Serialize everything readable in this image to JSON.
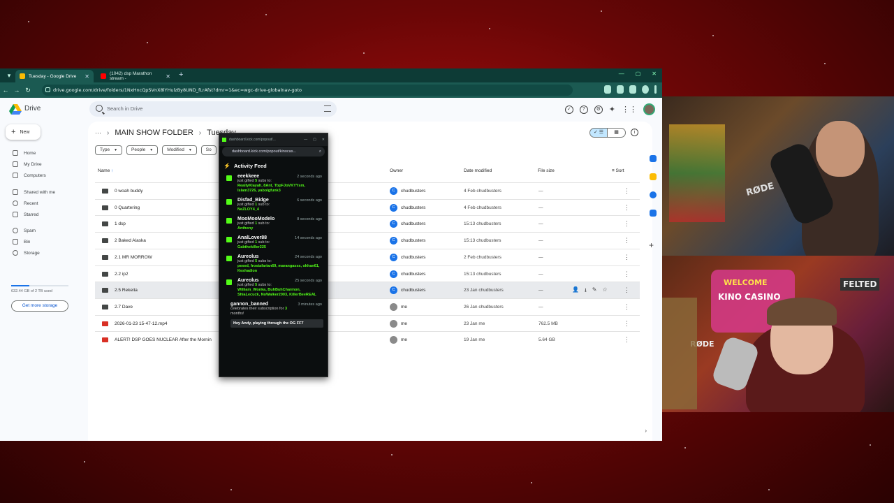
{
  "browser": {
    "tabs": [
      {
        "label": "Tuesday - Google Drive",
        "active": true,
        "favicon_color": "#fbbc04"
      },
      {
        "label": "(1042) dsp Marathon stream - ",
        "active": false,
        "favicon_color": "#ff0000"
      }
    ],
    "url": "drive.google.com/drive/folders/1NxHncQpSVnX8lYHulzBy8UND_fLrAfst?dmr=1&ec=wgc-drive-globalnav-goto"
  },
  "drive": {
    "app_name": "Drive",
    "search_placeholder": "Search in Drive",
    "new_label": "New",
    "nav": [
      {
        "label": "Home",
        "icon": "home-icon"
      },
      {
        "label": "My Drive",
        "icon": "drive-icon"
      },
      {
        "label": "Computers",
        "icon": "computer-icon"
      },
      {
        "label": "Shared with me",
        "icon": "people-icon"
      },
      {
        "label": "Recent",
        "icon": "clock-icon"
      },
      {
        "label": "Starred",
        "icon": "star-icon"
      },
      {
        "label": "Spam",
        "icon": "spam-icon"
      },
      {
        "label": "Bin",
        "icon": "trash-icon"
      },
      {
        "label": "Storage",
        "icon": "cloud-icon"
      }
    ],
    "storage_text": "632.44 GB of 2 TB used",
    "storage_fraction": 0.32,
    "get_storage_label": "Get more storage",
    "breadcrumb": [
      "MAIN SHOW FOLDER",
      "Tuesday"
    ],
    "filters": [
      "Type",
      "People",
      "Modified",
      "So"
    ],
    "columns": {
      "name": "Name",
      "owner": "Owner",
      "date": "Date modified",
      "size": "File size",
      "sort": "Sort"
    },
    "rows": [
      {
        "name": "0 woah buddy",
        "type": "folder",
        "owner_initial": "C",
        "owner": "chudbusters",
        "date": "4 Feb chudbusters",
        "size": "—"
      },
      {
        "name": "0 Quartering",
        "type": "folder",
        "owner_initial": "C",
        "owner": "chudbusters",
        "date": "4 Feb chudbusters",
        "size": "—"
      },
      {
        "name": "1 dsp",
        "type": "folder",
        "owner_initial": "C",
        "owner": "chudbusters",
        "date": "15:13 chudbusters",
        "size": "—"
      },
      {
        "name": "2 Baked Alaska",
        "type": "folder",
        "owner_initial": "C",
        "owner": "chudbusters",
        "date": "15:13 chudbusters",
        "size": "—"
      },
      {
        "name": "2.1 MR MORROW",
        "type": "folder",
        "owner_initial": "C",
        "owner": "chudbusters",
        "date": "2 Feb chudbusters",
        "size": "—"
      },
      {
        "name": "2.2 ip2",
        "type": "folder",
        "owner_initial": "C",
        "owner": "chudbusters",
        "date": "15:13 chudbusters",
        "size": "—"
      },
      {
        "name": "2.5 Rekeita",
        "type": "folder",
        "owner_initial": "C",
        "owner": "chudbusters",
        "date": "23 Jan chudbusters",
        "size": "—",
        "selected": true
      },
      {
        "name": "2.7 Dave",
        "type": "folder",
        "owner_initial": "",
        "owner": "me",
        "date": "26 Jan chudbusters",
        "size": "—"
      },
      {
        "name": "2026-01-23 15-47-12.mp4",
        "type": "video",
        "owner_initial": "",
        "owner": "me",
        "date": "23 Jan me",
        "size": "762.5 MB"
      },
      {
        "name": "ALERT! DSP GOES NUCLEAR After the Mornin",
        "type": "video",
        "owner_initial": "",
        "owner": "me",
        "date": "19 Jan me",
        "size": "5.64 GB"
      }
    ]
  },
  "popout": {
    "window_title": "dashboard.kick.com/popout/...",
    "url": "dashboard.kick.com/popout/kinocas...",
    "feed_title": "Activity Feed",
    "items": [
      {
        "user": "eeekkeee",
        "time": "2 seconds ago",
        "prefix": "just gifted",
        "count": "5",
        "suffix": "subs to:",
        "recipients": "ReallyKlayah, 8Ant, TbpFJoVKYYsm, Islam3726, yabolgfunk3"
      },
      {
        "user": "Disfad_Bidge",
        "time": "6 seconds ago",
        "prefix": "just gifted",
        "count": "1",
        "suffix": "sub to:",
        "recipients": "NeZLOY4_4"
      },
      {
        "user": "MooMooModelo",
        "time": "8 seconds ago",
        "prefix": "just gifted",
        "count": "1",
        "suffix": "sub to:",
        "recipients": "Anthony"
      },
      {
        "user": "AnalLover88",
        "time": "14 seconds ago",
        "prefix": "just gifted",
        "count": "1",
        "suffix": "sub to:",
        "recipients": "Gabthekiller225"
      },
      {
        "user": "Aureolus",
        "time": "24 seconds ago",
        "prefix": "just gifted",
        "count": "5",
        "suffix": "subs to:",
        "recipients": "pexed, frostafarian69, marangasss, okhan61, Keshadion"
      },
      {
        "user": "Aureolus",
        "time": "25 seconds ago",
        "prefix": "just gifted",
        "count": "5",
        "suffix": "subs to:",
        "recipients": "William_Wonka, BuhBuhCharmon, ShiaLecuck, NoWalker2003, KillerBeeREAL"
      }
    ],
    "sub_item": {
      "user": "gannon_banned",
      "time": "3 minutes ago",
      "text": "celebrates their subscription for",
      "months": "3",
      "months_label": "months!",
      "message": "Hey Andy, playing through the OG FF7"
    }
  },
  "cams": {
    "cam1_sign": "RØDE",
    "cam2_sign1": "WELCOME",
    "cam2_sign2": "KINO CASINO",
    "cam2_sign3": "FELTED",
    "cam2_mic": "RØDE"
  }
}
